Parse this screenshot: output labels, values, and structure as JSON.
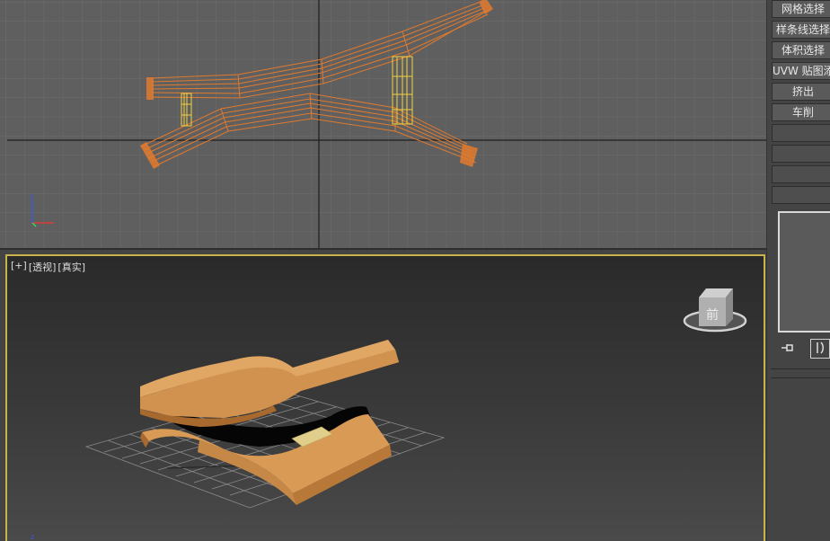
{
  "viewports": {
    "top": {
      "axis_label": "z"
    },
    "perspective": {
      "label_plus": "[+]",
      "label_view": "[透视]",
      "label_shading": "[真实]",
      "axis_label": "z",
      "viewcube_face": "前"
    }
  },
  "command_panel": {
    "modifiers": [
      "网格选择",
      "样条线选择",
      "体积选择",
      "UVW 贴图添加",
      "挤出",
      "车削"
    ]
  },
  "colors": {
    "viewport_top_bg": "#5f5f5f",
    "grid_line": "#6c6c6c",
    "spline_orange": "#e07a2e",
    "selected_yellow": "#f0d040",
    "wood_tan": "#d89a55",
    "active_border": "#c8b24a"
  }
}
